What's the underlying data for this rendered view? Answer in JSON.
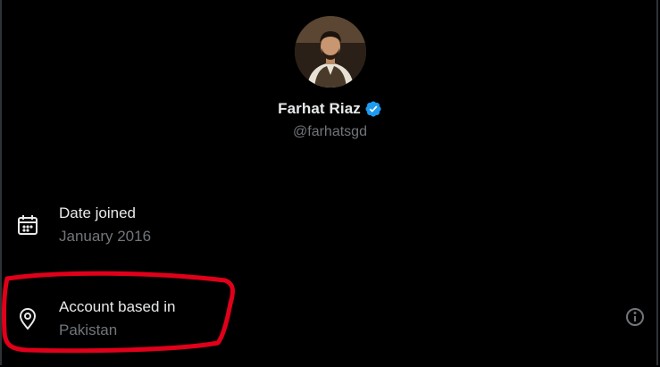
{
  "profile": {
    "display_name": "Farhat Riaz",
    "handle": "@farhatsgd",
    "verified": true
  },
  "about": {
    "date_joined": {
      "title": "Date joined",
      "value": "January 2016",
      "icon": "calendar-icon"
    },
    "account_location": {
      "title": "Account based in",
      "value": "Pakistan",
      "icon": "location-pin-icon",
      "info_icon": "info-icon"
    }
  },
  "colors": {
    "background": "#000000",
    "primary_text": "#e7e9ea",
    "secondary_text": "#71767b",
    "verified_badge": "#1d9bf0",
    "annotation": "#e0001a"
  }
}
